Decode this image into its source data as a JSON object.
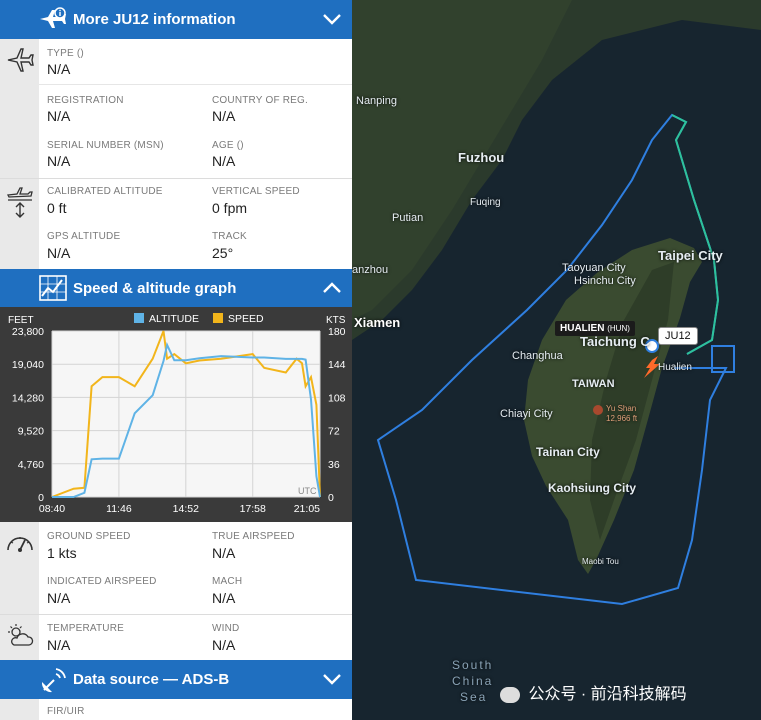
{
  "header_more": {
    "title": "More JU12 information"
  },
  "aircraft": {
    "type_label": "TYPE ()",
    "type_value": "N/A",
    "registration_label": "REGISTRATION",
    "registration_value": "N/A",
    "country_label": "COUNTRY OF REG.",
    "country_value": "N/A",
    "serial_label": "SERIAL NUMBER (MSN)",
    "serial_value": "N/A",
    "age_label": "AGE ()",
    "age_value": "N/A"
  },
  "altitude": {
    "calibrated_label": "CALIBRATED ALTITUDE",
    "calibrated_value": "0 ft",
    "vspeed_label": "VERTICAL SPEED",
    "vspeed_value": "0 fpm",
    "gps_label": "GPS ALTITUDE",
    "gps_value": "N/A",
    "track_label": "TRACK",
    "track_value": "25°"
  },
  "graph_header": {
    "title": "Speed & altitude graph"
  },
  "graph": {
    "left_unit": "FEET",
    "right_unit": "KTS",
    "legend_altitude": "ALTITUDE",
    "legend_speed": "SPEED",
    "altitude_color": "#5fb3e6",
    "speed_color": "#f2b51b",
    "y_left_ticks": [
      "23,800",
      "19,040",
      "14,280",
      "9,520",
      "4,760",
      "0"
    ],
    "y_right_ticks": [
      "180",
      "144",
      "108",
      "72",
      "36",
      "0"
    ],
    "x_ticks": [
      "08:40",
      "11:46",
      "14:52",
      "17:58",
      "21:05"
    ],
    "tz_label": "UTC"
  },
  "chart_data": {
    "type": "line",
    "x": [
      "08:40",
      "09:40",
      "10:10",
      "10:30",
      "11:00",
      "11:46",
      "12:30",
      "13:20",
      "13:50",
      "14:00",
      "14:20",
      "14:52",
      "15:30",
      "16:30",
      "17:58",
      "18:30",
      "19:30",
      "20:00",
      "20:15",
      "20:25",
      "20:40",
      "20:55",
      "21:05"
    ],
    "series": [
      {
        "name": "ALTITUDE",
        "unit": "FEET",
        "values": [
          0,
          0,
          600,
          5400,
          5500,
          5500,
          12000,
          14600,
          19500,
          21800,
          19600,
          19600,
          19900,
          20200,
          20000,
          20000,
          19800,
          19800,
          19800,
          19700,
          14000,
          3000,
          0
        ]
      },
      {
        "name": "SPEED",
        "unit": "KTS",
        "values": [
          0,
          9,
          10,
          120,
          130,
          130,
          120,
          150,
          180,
          150,
          155,
          145,
          148,
          150,
          155,
          140,
          135,
          150,
          145,
          120,
          130,
          100,
          0
        ]
      }
    ],
    "ylim_left": [
      0,
      23800
    ],
    "ylim_right": [
      0,
      180
    ]
  },
  "speed": {
    "ground_label": "GROUND SPEED",
    "ground_value": "1 kts",
    "true_label": "TRUE AIRSPEED",
    "true_value": "N/A",
    "indicated_label": "INDICATED AIRSPEED",
    "indicated_value": "N/A",
    "mach_label": "MACH",
    "mach_value": "N/A"
  },
  "weather": {
    "temp_label": "TEMPERATURE",
    "temp_value": "N/A",
    "wind_label": "WIND",
    "wind_value": "N/A"
  },
  "datasource_header": {
    "title": "Data source — ADS-B"
  },
  "fir": {
    "label": "FIR/UIR"
  },
  "map": {
    "labels": [
      "Nanping",
      "Fuzhou",
      "Fuqing",
      "Putian",
      "anzhou",
      "Xiamen",
      "Taipei City",
      "Taoyuan City",
      "Hsinchu City",
      "Taichung C",
      "Changhua",
      "TAIWAN",
      "Chiayi City",
      "Yu Shan",
      "12,966 ft",
      "Tainan City",
      "Kaohsiung City",
      "Maobi Tou",
      "Hualien",
      "South",
      "China",
      "Sea"
    ],
    "airport_label": "HUALIEN",
    "airport_code": "(HUN)",
    "flight_label": "JU12",
    "watermark": "公众号 · 前沿科技解码"
  }
}
